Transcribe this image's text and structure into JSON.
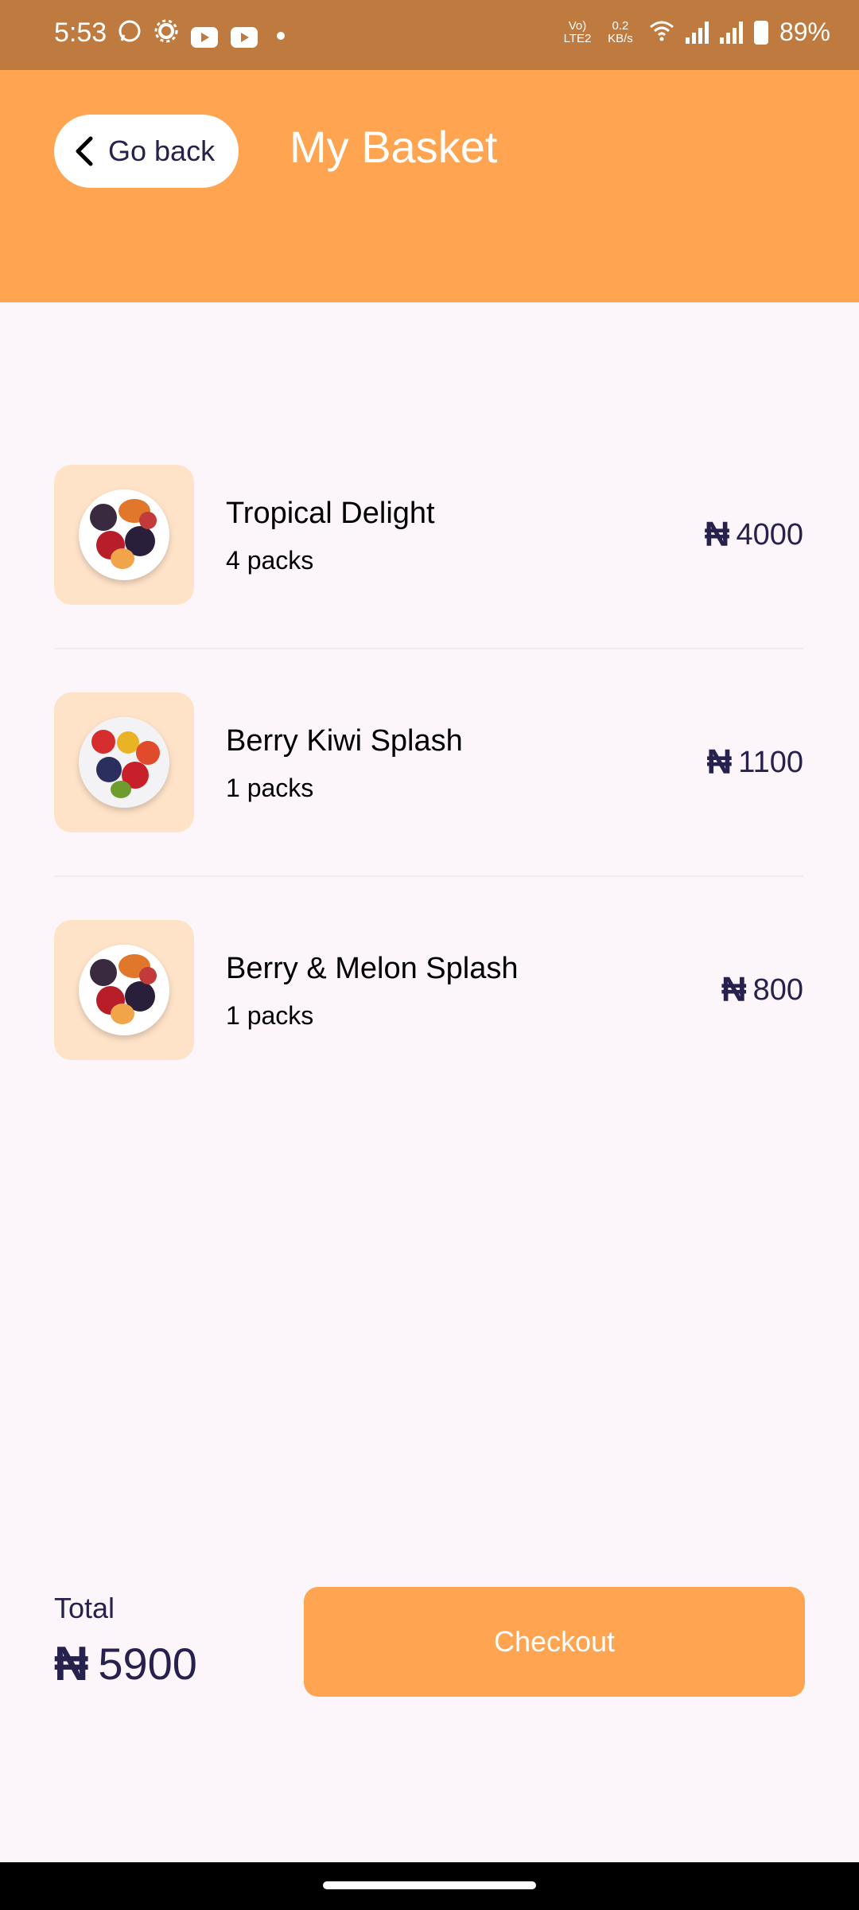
{
  "status_bar": {
    "time": "5:53",
    "network_lte": "Vo) LTE2",
    "data_rate": "0.2 KB/s",
    "battery": "89%",
    "icons": [
      "whatsapp-icon",
      "settings-icon",
      "youtube-icon",
      "youtube-icon",
      "dot-icon",
      "wifi-icon",
      "signal-icon",
      "signal-icon",
      "battery-icon"
    ]
  },
  "header": {
    "back_label": "Go back",
    "title": "My Basket"
  },
  "items": [
    {
      "name": "Tropical Delight",
      "qty": "4 packs",
      "price": "4000",
      "currency": "₦"
    },
    {
      "name": "Berry Kiwi Splash",
      "qty": "1 packs",
      "price": "1100",
      "currency": "₦"
    },
    {
      "name": "Berry & Melon Splash",
      "qty": "1 packs",
      "price": "800",
      "currency": "₦"
    }
  ],
  "footer": {
    "total_label": "Total",
    "currency": "₦",
    "total_value": "5900",
    "checkout_label": "Checkout"
  },
  "colors": {
    "accent": "#FFA451",
    "status_bar": "#BE7A3F",
    "text_dark": "#27214D",
    "thumb_bg": "#FFE3C9",
    "page_bg": "#FCF6FB"
  }
}
